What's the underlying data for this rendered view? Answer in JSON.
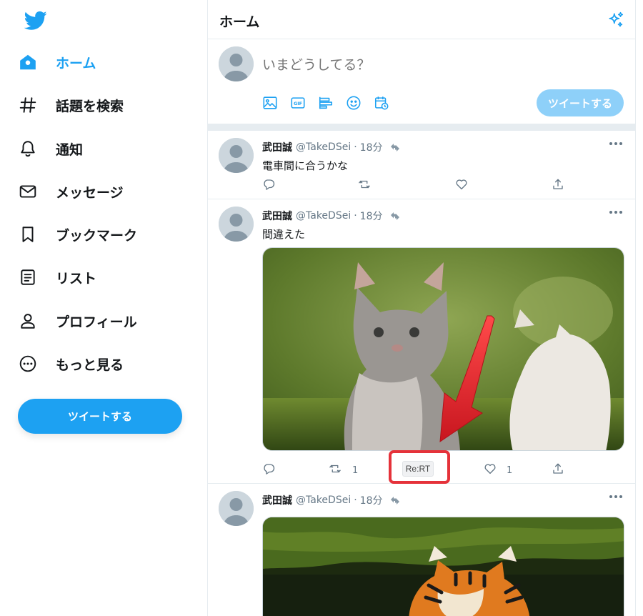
{
  "sidebar": {
    "nav": [
      {
        "label": "ホーム",
        "icon": "home-icon",
        "active": true
      },
      {
        "label": "話題を検索",
        "icon": "hashtag-icon",
        "active": false
      },
      {
        "label": "通知",
        "icon": "bell-icon",
        "active": false
      },
      {
        "label": "メッセージ",
        "icon": "mail-icon",
        "active": false
      },
      {
        "label": "ブックマーク",
        "icon": "bookmark-icon",
        "active": false
      },
      {
        "label": "リスト",
        "icon": "list-icon",
        "active": false
      },
      {
        "label": "プロフィール",
        "icon": "person-icon",
        "active": false
      },
      {
        "label": "もっと見る",
        "icon": "more-circle-icon",
        "active": false
      }
    ],
    "tweet_button": "ツイートする"
  },
  "header": {
    "title": "ホーム"
  },
  "compose": {
    "placeholder": "いまどうしてる？",
    "tweet_button": "ツイートする"
  },
  "tweets": [
    {
      "name": "武田誠",
      "handle": "@TakeDSei",
      "time": "18分",
      "text": "電車間に合うかな",
      "retweets": "",
      "likes": "",
      "media": "none"
    },
    {
      "name": "武田誠",
      "handle": "@TakeDSei",
      "time": "18分",
      "text": "間違えた",
      "retweets": "1",
      "likes": "1",
      "media": "cat-photo",
      "extension_button": "Re:RT"
    },
    {
      "name": "武田誠",
      "handle": "@TakeDSei",
      "time": "18分",
      "text": "",
      "media": "tiger-photo"
    }
  ],
  "colors": {
    "accent": "#1da1f2",
    "highlight": "#e5323a",
    "muted": "#657786"
  }
}
